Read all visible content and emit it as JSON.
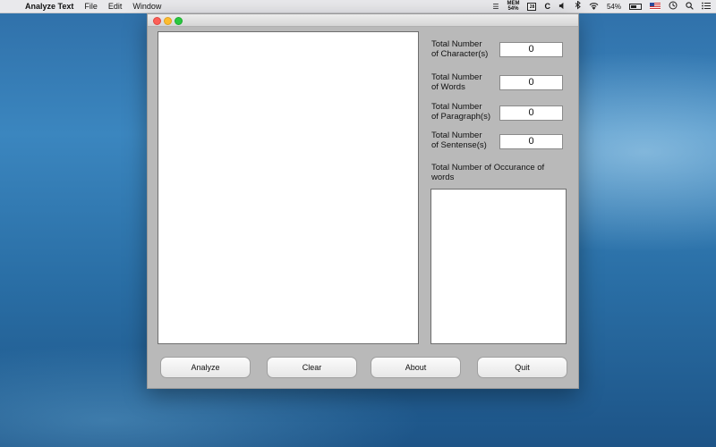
{
  "menubar": {
    "app_name": "Analyze Text",
    "menus": [
      "File",
      "Edit",
      "Window"
    ],
    "status": {
      "mem_label": "MEM",
      "mem_value": "54%",
      "calendar_day": "28",
      "c_label": "C",
      "battery_percent": "54%"
    }
  },
  "stats": [
    {
      "label_line1": "Total Number",
      "label_line2": "of Character(s)",
      "value": "0"
    },
    {
      "label_line1": "Total Number",
      "label_line2": "of Words",
      "value": "0"
    },
    {
      "label_line1": "Total Number",
      "label_line2": "of Paragraph(s)",
      "value": "0"
    },
    {
      "label_line1": "Total Number",
      "label_line2": "of Sentense(s)",
      "value": "0"
    }
  ],
  "occurrence": {
    "label_line1": "Total Number of Occurance of",
    "label_line2": "words"
  },
  "buttons": {
    "analyze": "Analyze",
    "clear": "Clear",
    "about": "About",
    "quit": "Quit"
  },
  "icons": {
    "apple": "apple-icon",
    "list": "list-icon",
    "volume": "volume-icon",
    "bluetooth": "bluetooth-icon",
    "wifi": "wifi-icon",
    "clock": "clock-icon",
    "search": "search-icon",
    "menu": "menu-icon"
  },
  "colors": {
    "close": "#fc5f57",
    "minimize": "#fdbc2e",
    "maximize": "#29c840",
    "window_bg": "#b9b9b9"
  }
}
